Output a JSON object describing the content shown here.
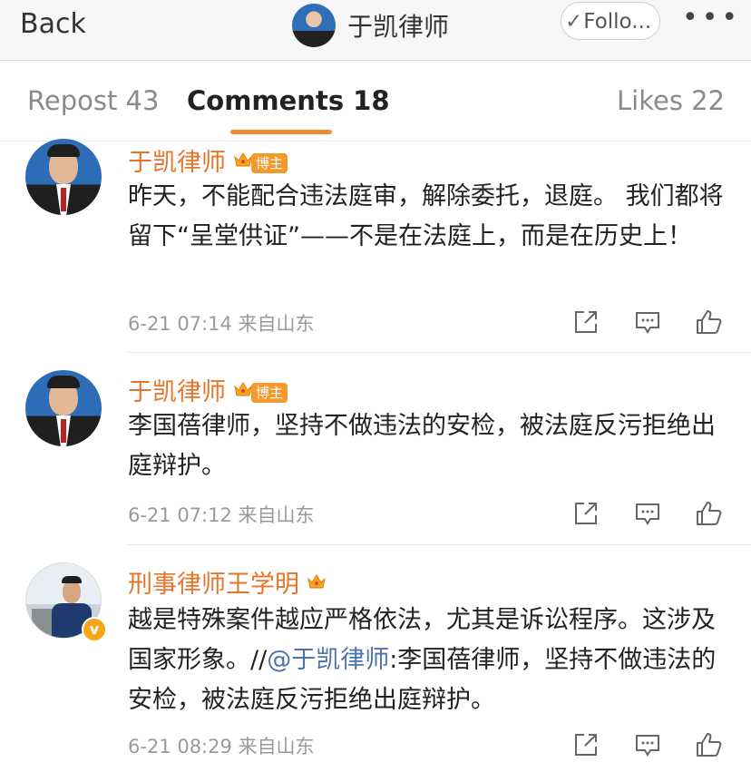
{
  "nav": {
    "back_label": "Back",
    "title": "于凯律师",
    "follow_label": "Follo...",
    "more_label": "•••"
  },
  "tabs": [
    {
      "label": "Repost 43"
    },
    {
      "label": "Comments 18",
      "active": true
    },
    {
      "label": "Likes 22"
    }
  ],
  "comments": [
    {
      "author": "于凯律师",
      "badge": "博主",
      "text": "昨天，不能配合违法庭审，解除委托，退庭。 我们都将留下“呈堂供证”——不是在法庭上，而是在历史上！",
      "time": "6-21 07:14",
      "source": "来自山东"
    },
    {
      "author": "于凯律师",
      "badge": "博主",
      "text": "李国蓓律师，坚持不做违法的安检，被法庭反污拒绝出庭辩护。",
      "time": "6-21 07:12",
      "source": "来自山东"
    },
    {
      "author": "刑事律师王学明",
      "text_before": "越是特殊案件越应严格依法，尤其是诉讼程序。这涉及国家形象。//",
      "mention": "@于凯律师",
      "text_after": ":李国蓓律师，坚持不做违法的安检，被法庭反污拒绝出庭辩护。",
      "time": "6-21 08:29",
      "source": "来自山东"
    }
  ],
  "icons": {
    "share": "share-icon",
    "comment": "comment-icon",
    "like": "like-icon",
    "crown": "crown-icon",
    "verified": "verified-icon"
  },
  "colors": {
    "author": "#e8742a",
    "accent": "#f08a30",
    "mention": "#4c72b0",
    "badge": "#f39a2b",
    "verified": "#f7a51b"
  }
}
